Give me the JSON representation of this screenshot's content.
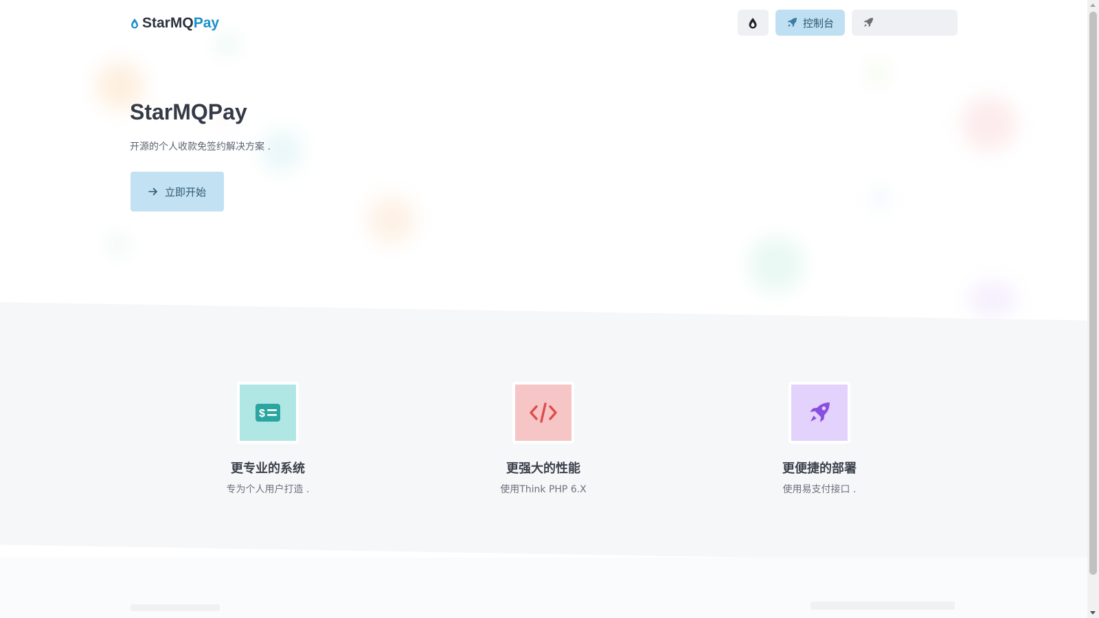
{
  "brand": {
    "name_part1": "StarMQ",
    "name_part2": "Pay",
    "accent_color": "#1a8fc9"
  },
  "nav": {
    "theme_icon": "drop-icon",
    "console_label": "控制台",
    "console_icon": "rocket-icon",
    "login_label": "",
    "login_icon": "rocket-icon"
  },
  "hero": {
    "title": "StarMQPay",
    "subtitle": "开源的个人收款免签约解决方案 .",
    "start_label": "立即开始",
    "start_icon": "arrow-right-icon"
  },
  "features": [
    {
      "icon": "money-bill-icon",
      "color": "#2aa5a0",
      "title": "更专业的系统",
      "desc": "专为个人用户打造 ."
    },
    {
      "icon": "code-icon",
      "color": "#e04b4b",
      "title": "更强大的性能",
      "desc": "使用Think PHP 6.X"
    },
    {
      "icon": "rocket-icon",
      "color": "#8a4fe0",
      "title": "更便捷的部署",
      "desc": "使用易支付接口 ."
    }
  ]
}
